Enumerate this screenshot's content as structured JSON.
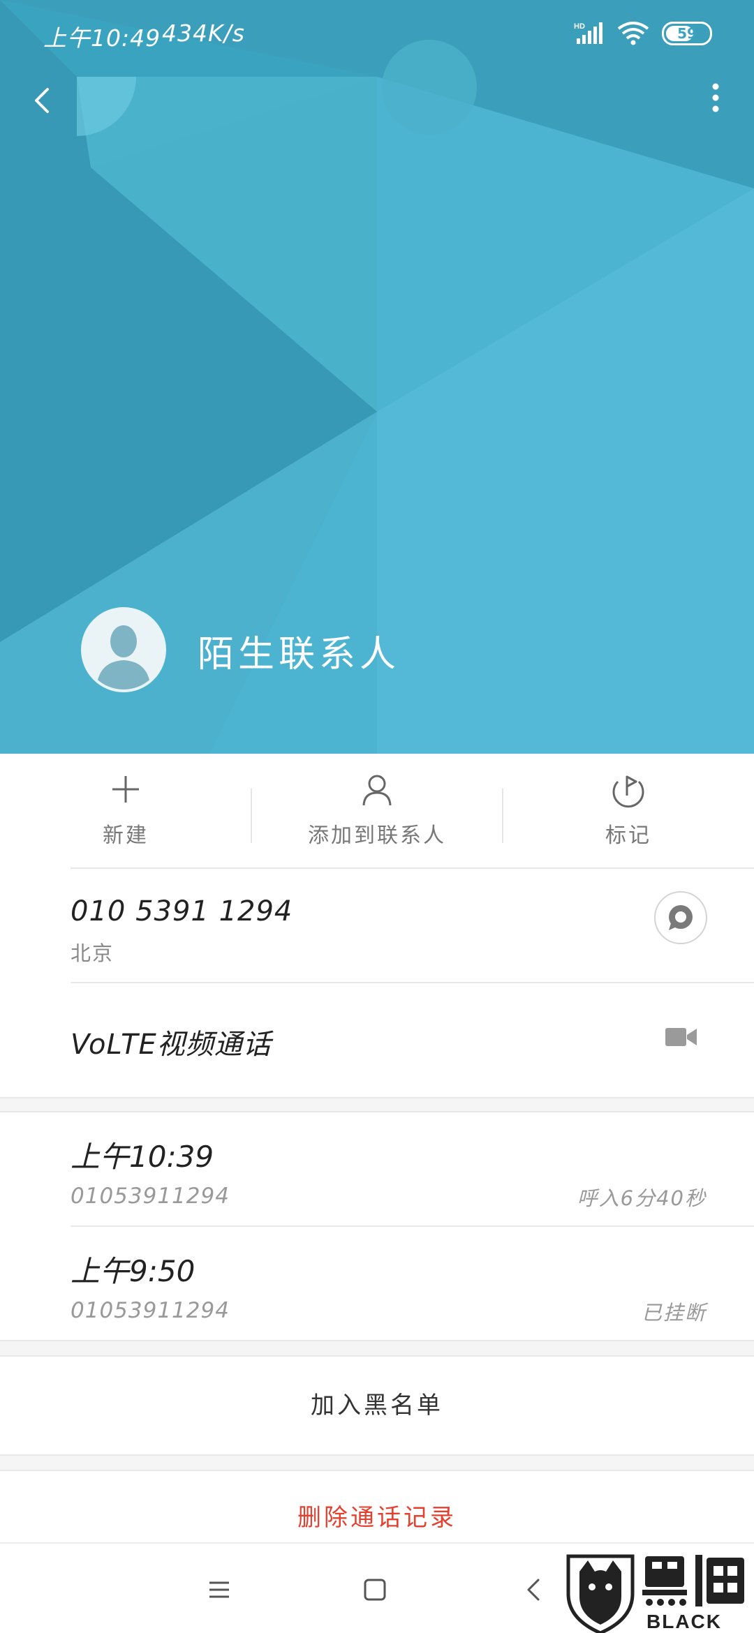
{
  "status_bar": {
    "time": "上午10:49",
    "network_speed": "434K/s",
    "hd_badge": "HD",
    "battery_percent": 59,
    "battery_label": "59",
    "icons": [
      "signal-icon",
      "wifi-icon",
      "battery-icon"
    ]
  },
  "header": {
    "contact_name": "陌生联系人",
    "colors": {
      "primary": "#3aa3bf",
      "light": "#56bbd8",
      "dark": "#2f8fad"
    }
  },
  "actions": [
    {
      "label": "新建",
      "icon": "plus-icon"
    },
    {
      "label": "添加到联系人",
      "icon": "person-icon"
    },
    {
      "label": "标记",
      "icon": "flag-icon"
    }
  ],
  "phone": {
    "number": "010 5391 1294",
    "location": "北京",
    "message_icon": "message-icon"
  },
  "video_call": {
    "label": "VoLTE视频通话",
    "icon": "video-camera-icon"
  },
  "call_logs": [
    {
      "time": "上午10:39",
      "number": "01053911294",
      "status": "呼入6分40秒"
    },
    {
      "time": "上午9:50",
      "number": "01053911294",
      "status": "已挂断"
    }
  ],
  "buttons": {
    "block": "加入黑名单",
    "delete": "删除通话记录",
    "delete_color": "#e3402f"
  },
  "navbar": {
    "icons": [
      "menu-icon",
      "home-icon",
      "back-icon"
    ]
  },
  "watermark": {
    "text": "BLACK CAT"
  }
}
